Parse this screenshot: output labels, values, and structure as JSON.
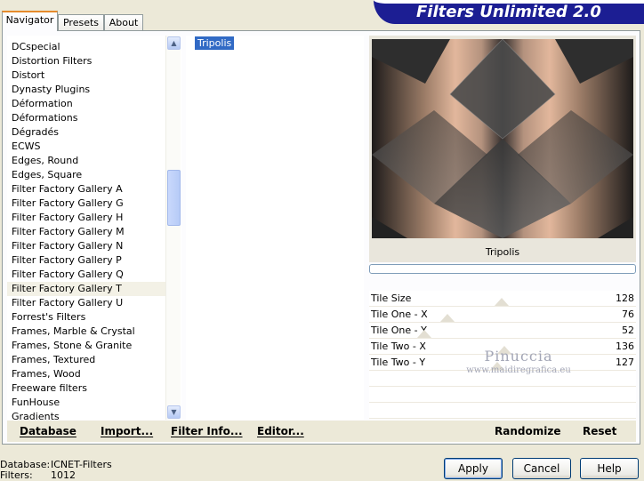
{
  "tabs": [
    {
      "label": "Navigator",
      "active": true
    },
    {
      "label": "Presets",
      "active": false
    },
    {
      "label": "About",
      "active": false
    }
  ],
  "banner": {
    "title": "Filters Unlimited 2.0"
  },
  "categories": {
    "items": [
      "DCspecial",
      "Distortion Filters",
      "Distort",
      "Dynasty Plugins",
      "Déformation",
      "Déformations",
      "Dégradés",
      "ECWS",
      "Edges, Round",
      "Edges, Square",
      "Filter Factory Gallery A",
      "Filter Factory Gallery G",
      "Filter Factory Gallery H",
      "Filter Factory Gallery M",
      "Filter Factory Gallery N",
      "Filter Factory Gallery P",
      "Filter Factory Gallery Q",
      "Filter Factory Gallery T",
      "Filter Factory Gallery U",
      "Forrest's Filters",
      "Frames, Marble & Crystal",
      "Frames, Stone & Granite",
      "Frames, Textured",
      "Frames, Wood",
      "Freeware filters",
      "FunHouse",
      "Gradients"
    ],
    "selected": "Filter Factory Gallery T",
    "scroll_up_icon": "▲",
    "scroll_down_icon": "▼"
  },
  "filters": {
    "items": [
      "Tripolis"
    ],
    "selected": "Tripolis"
  },
  "preview": {
    "filter_name": "Tripolis",
    "progress": 0
  },
  "params": [
    {
      "label": "Tile Size",
      "value": "128"
    },
    {
      "label": "Tile One - X",
      "value": "76"
    },
    {
      "label": "Tile One - Y",
      "value": "52"
    },
    {
      "label": "Tile Two - X",
      "value": "136"
    },
    {
      "label": "Tile Two - Y",
      "value": "127"
    }
  ],
  "watermark": {
    "main": "Pinuccia",
    "sub": "www.maidiregrafica.eu"
  },
  "links": {
    "database": "Database",
    "import": "Import...",
    "filter_info": "Filter Info...",
    "editor": "Editor...",
    "randomize": "Randomize",
    "reset": "Reset"
  },
  "footer": {
    "database_label": "Database:",
    "database_value": "ICNET-Filters",
    "filters_label": "Filters:",
    "filters_value": "1012"
  },
  "buttons": {
    "apply": "Apply",
    "cancel": "Cancel",
    "help": "Help"
  },
  "colors": {
    "selection": "#316ac5",
    "banner": "#1c1e93",
    "tab_accent": "#e68b2c"
  }
}
